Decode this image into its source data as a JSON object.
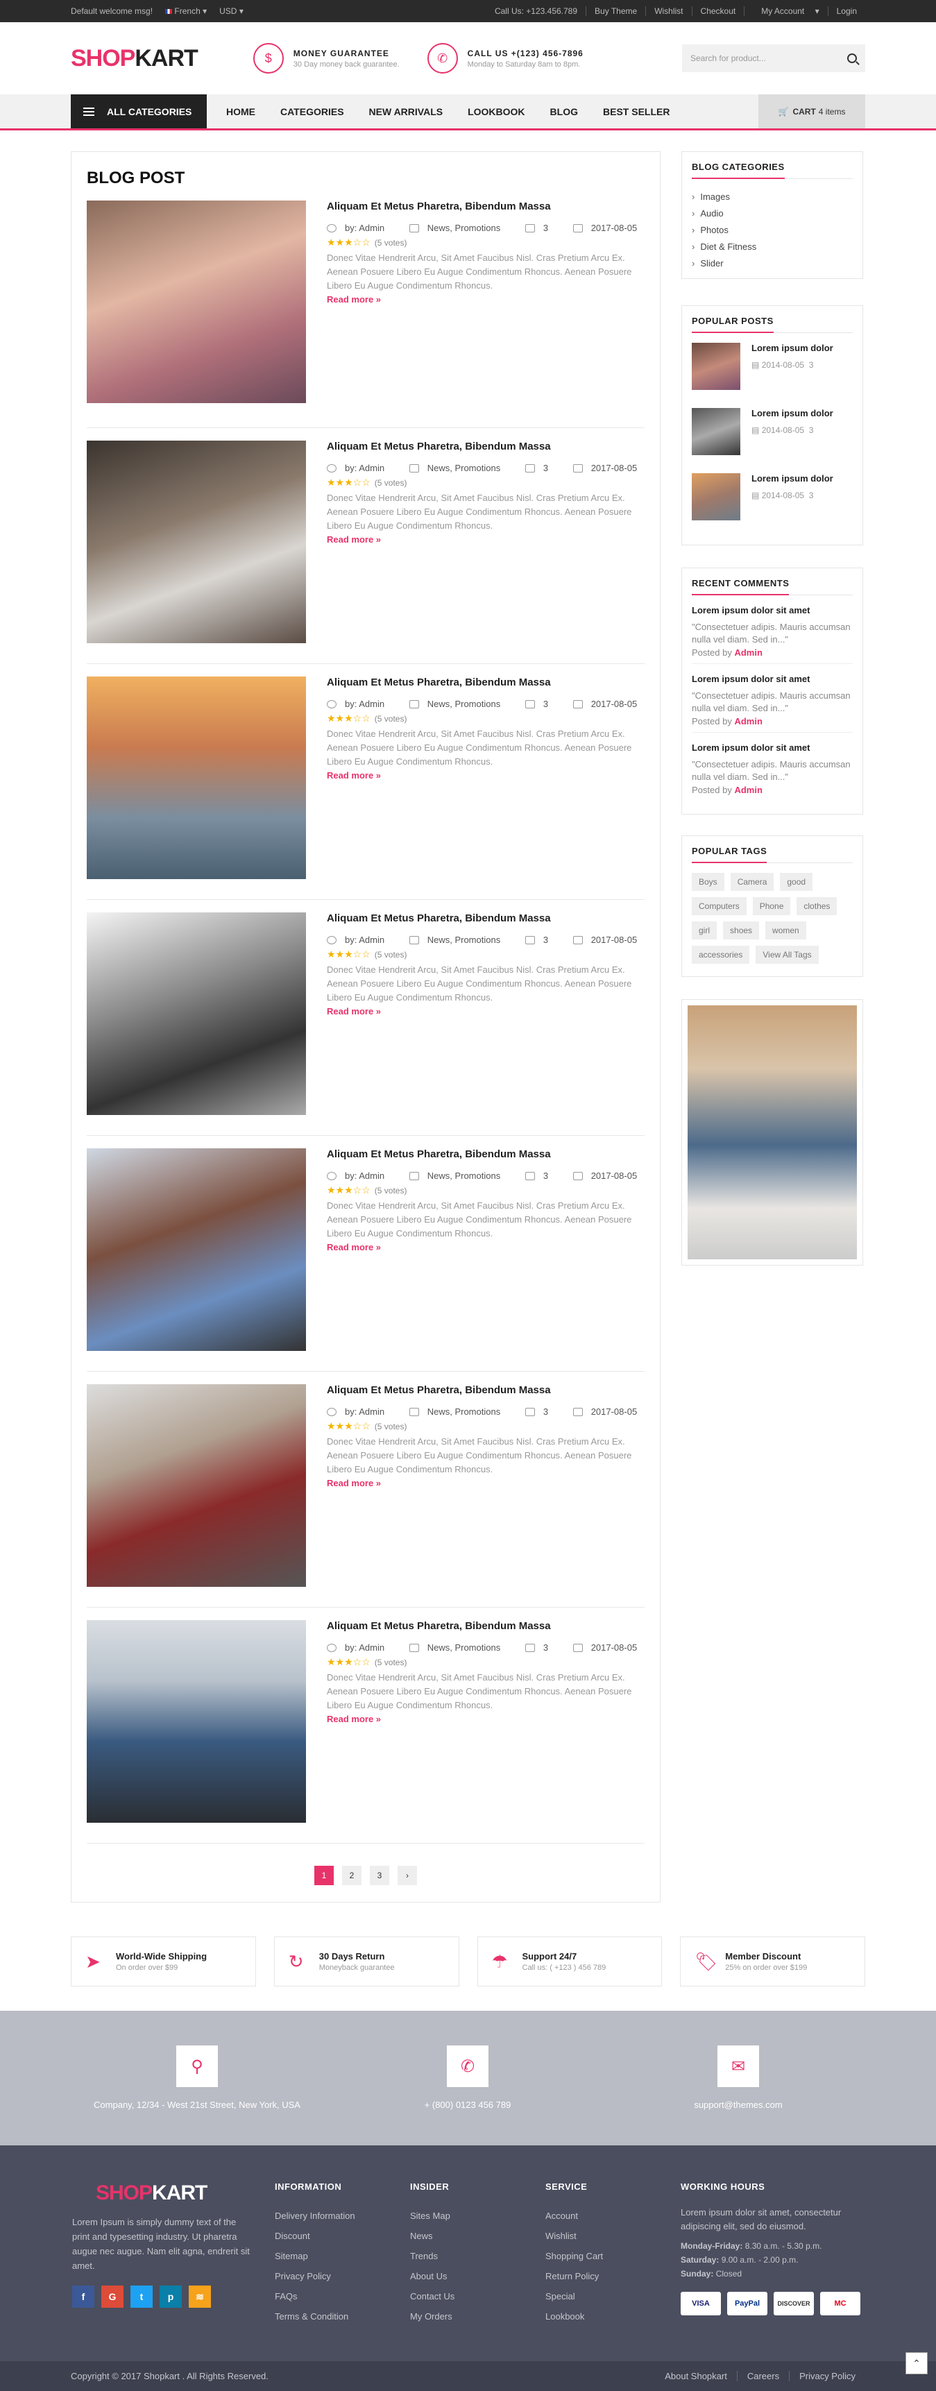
{
  "topbar": {
    "welcome": "Default welcome msg!",
    "language": "French",
    "currency": "USD",
    "links": [
      "Call Us: +123.456.789",
      "Buy Theme",
      "Wishlist",
      "Checkout",
      "My Account",
      "Login"
    ]
  },
  "header": {
    "logo_a": "SHOP",
    "logo_b": "KART",
    "guarantee_title": "MONEY GUARANTEE",
    "guarantee_sub": "30 Day money back guarantee.",
    "call_title": "CALL US +(123) 456-7896",
    "call_sub": "Monday to Saturday 8am to 8pm.",
    "search_placeholder": "Search for product..."
  },
  "nav": {
    "all_categories": "ALL CATEGORIES",
    "items": [
      "HOME",
      "CATEGORIES",
      "NEW ARRIVALS",
      "LOOKBOOK",
      "BLOG",
      "BEST SELLER"
    ],
    "cart_label": "CART",
    "cart_count": "4 items"
  },
  "blog": {
    "heading": "BLOG POST",
    "posts": [
      {
        "title": "Aliquam Et Metus Pharetra, Bibendum Massa",
        "author": "by: Admin",
        "category": "News, Promotions",
        "comments": "3",
        "date": "2017-08-05",
        "rating": "★★★☆☆",
        "votes": "(5 votes)",
        "excerpt": "Donec Vitae Hendrerit Arcu, Sit Amet Faucibus Nisl. Cras Pretium Arcu Ex. Aenean Posuere Libero Eu Augue Condimentum Rhoncus. Aenean Posuere Libero Eu Augue Condimentum Rhoncus.",
        "more": "Read more »",
        "image": "woman-portrait-photo"
      },
      {
        "title": "Aliquam Et Metus Pharetra, Bibendum Massa",
        "author": "by: Admin",
        "category": "News, Promotions",
        "comments": "3",
        "date": "2017-08-05",
        "rating": "★★★☆☆",
        "votes": "(5 votes)",
        "excerpt": "Donec Vitae Hendrerit Arcu, Sit Amet Faucibus Nisl. Cras Pretium Arcu Ex. Aenean Posuere Libero Eu Augue Condimentum Rhoncus. Aenean Posuere Libero Eu Augue Condimentum Rhoncus.",
        "more": "Read more »",
        "image": "bearded-man-photo"
      },
      {
        "title": "Aliquam Et Metus Pharetra, Bibendum Massa",
        "author": "by: Admin",
        "category": "News, Promotions",
        "comments": "3",
        "date": "2017-08-05",
        "rating": "★★★☆☆",
        "votes": "(5 votes)",
        "excerpt": "Donec Vitae Hendrerit Arcu, Sit Amet Faucibus Nisl. Cras Pretium Arcu Ex. Aenean Posuere Libero Eu Augue Condimentum Rhoncus. Aenean Posuere Libero Eu Augue Condimentum Rhoncus.",
        "more": "Read more »",
        "image": "little-girl-sunset-photo"
      },
      {
        "title": "Aliquam Et Metus Pharetra, Bibendum Massa",
        "author": "by: Admin",
        "category": "News, Promotions",
        "comments": "3",
        "date": "2017-08-05",
        "rating": "★★★☆☆",
        "votes": "(5 votes)",
        "excerpt": "Donec Vitae Hendrerit Arcu, Sit Amet Faucibus Nisl. Cras Pretium Arcu Ex. Aenean Posuere Libero Eu Augue Condimentum Rhoncus. Aenean Posuere Libero Eu Augue Condimentum Rhoncus.",
        "more": "Read more »",
        "image": "man-beanie-bw-photo"
      },
      {
        "title": "Aliquam Et Metus Pharetra, Bibendum Massa",
        "author": "by: Admin",
        "category": "News, Promotions",
        "comments": "3",
        "date": "2017-08-05",
        "rating": "★★★☆☆",
        "votes": "(5 votes)",
        "excerpt": "Donec Vitae Hendrerit Arcu, Sit Amet Faucibus Nisl. Cras Pretium Arcu Ex. Aenean Posuere Libero Eu Augue Condimentum Rhoncus. Aenean Posuere Libero Eu Augue Condimentum Rhoncus.",
        "more": "Read more »",
        "image": "woman-hat-photo"
      },
      {
        "title": "Aliquam Et Metus Pharetra, Bibendum Massa",
        "author": "by: Admin",
        "category": "News, Promotions",
        "comments": "3",
        "date": "2017-08-05",
        "rating": "★★★☆☆",
        "votes": "(5 votes)",
        "excerpt": "Donec Vitae Hendrerit Arcu, Sit Amet Faucibus Nisl. Cras Pretium Arcu Ex. Aenean Posuere Libero Eu Augue Condimentum Rhoncus. Aenean Posuere Libero Eu Augue Condimentum Rhoncus.",
        "more": "Read more »",
        "image": "friends-winter-hats-photo"
      },
      {
        "title": "Aliquam Et Metus Pharetra, Bibendum Massa",
        "author": "by: Admin",
        "category": "News, Promotions",
        "comments": "3",
        "date": "2017-08-05",
        "rating": "★★★☆☆",
        "votes": "(5 votes)",
        "excerpt": "Donec Vitae Hendrerit Arcu, Sit Amet Faucibus Nisl. Cras Pretium Arcu Ex. Aenean Posuere Libero Eu Augue Condimentum Rhoncus. Aenean Posuere Libero Eu Augue Condimentum Rhoncus.",
        "more": "Read more »",
        "image": "man-glasses-denim-photo"
      }
    ],
    "pages": [
      "1",
      "2",
      "3",
      "›"
    ]
  },
  "sidebar": {
    "categories_title": "BLOG CATEGORIES",
    "categories": [
      "Images",
      "Audio",
      "Photos",
      "Diet & Fitness",
      "Slider"
    ],
    "popular_title": "POPULAR POSTS",
    "popular": [
      {
        "title": "Lorem ipsum dolor",
        "date": "2014-08-05",
        "comments": "3"
      },
      {
        "title": "Lorem ipsum dolor",
        "date": "2014-08-05",
        "comments": "3"
      },
      {
        "title": "Lorem ipsum dolor",
        "date": "2014-08-05",
        "comments": "3"
      }
    ],
    "comments_title": "RECENT COMMENTS",
    "comments": [
      {
        "title": "Lorem ipsum dolor sit amet",
        "text": "\"Consectetuer adipis. Mauris accumsan nulla vel diam. Sed in...\"",
        "posted": "Posted by",
        "author": "Admin"
      },
      {
        "title": "Lorem ipsum dolor sit amet",
        "text": "\"Consectetuer adipis. Mauris accumsan nulla vel diam. Sed in...\"",
        "posted": "Posted by",
        "author": "Admin"
      },
      {
        "title": "Lorem ipsum dolor sit amet",
        "text": "\"Consectetuer adipis. Mauris accumsan nulla vel diam. Sed in...\"",
        "posted": "Posted by",
        "author": "Admin"
      }
    ],
    "tags_title": "POPULAR TAGS",
    "tags": [
      "Boys",
      "Camera",
      "good",
      "Computers",
      "Phone",
      "clothes",
      "girl",
      "shoes",
      "women",
      "accessories",
      "View All Tags"
    ]
  },
  "features": [
    {
      "title": "World-Wide Shipping",
      "sub": "On order over $99",
      "icon": "paper-plane-icon"
    },
    {
      "title": "30 Days Return",
      "sub": "Moneyback guarantee",
      "icon": "return-icon"
    },
    {
      "title": "Support 24/7",
      "sub": "Call us: ( +123 ) 456 789",
      "icon": "umbrella-icon"
    },
    {
      "title": "Member Discount",
      "sub": "25% on order over $199",
      "icon": "tag-icon"
    }
  ],
  "contact": {
    "address": "Company, 12/34 - West 21st Street, New York, USA",
    "phone": "+ (800) 0123 456 789",
    "email": "support@themes.com"
  },
  "footer": {
    "logo_a": "SHOP",
    "logo_b": "KART",
    "about": "Lorem Ipsum is simply dummy text of the print and typesetting industry. Ut pharetra augue nec augue. Nam elit agna, endrerit sit amet.",
    "info_title": "INFORMATION",
    "info": [
      "Delivery Information",
      "Discount",
      "Sitemap",
      "Privacy Policy",
      "FAQs",
      "Terms & Condition"
    ],
    "insider_title": "INSIDER",
    "insider": [
      "Sites Map",
      "News",
      "Trends",
      "About Us",
      "Contact Us",
      "My Orders"
    ],
    "service_title": "SERVICE",
    "service": [
      "Account",
      "Wishlist",
      "Shopping Cart",
      "Return Policy",
      "Special",
      "Lookbook"
    ],
    "hours_title": "WORKING HOURS",
    "hours_text": "Lorem ipsum dolor sit amet, consectetur adipiscing elit, sed do eiusmod.",
    "hours": [
      {
        "day": "Monday-Friday:",
        "time": "8.30 a.m. - 5.30 p.m."
      },
      {
        "day": "Saturday:",
        "time": "9.00 a.m. - 2.00 p.m."
      },
      {
        "day": "Sunday:",
        "time": "Closed"
      }
    ],
    "cards": [
      "VISA",
      "PayPal",
      "DISCOVER",
      "MC"
    ]
  },
  "bottom": {
    "copyright": "Copyright © 2017 Shopkart . All Rights Reserved.",
    "links": [
      "About Shopkart",
      "Careers",
      "Privacy Policy"
    ]
  },
  "colors": {
    "accent": "#e8336a",
    "dark": "#222222",
    "footer": "#4b4e5e"
  }
}
